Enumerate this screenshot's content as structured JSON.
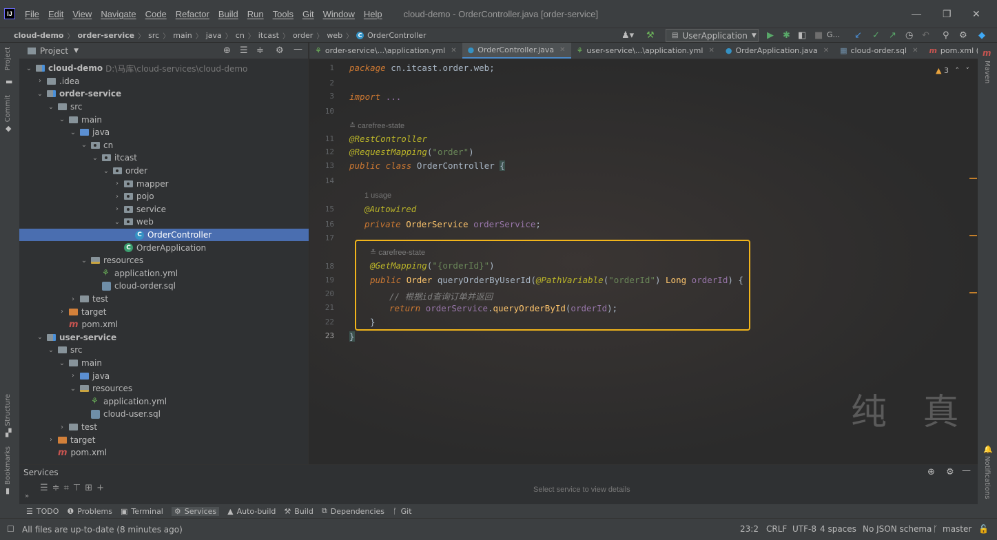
{
  "app": {
    "menu": [
      "File",
      "Edit",
      "View",
      "Navigate",
      "Code",
      "Refactor",
      "Build",
      "Run",
      "Tools",
      "Git",
      "Window",
      "Help"
    ],
    "window_title": "cloud-demo - OrderController.java [order-service]",
    "logo": "IJ"
  },
  "breadcrumb": [
    "cloud-demo",
    "order-service",
    "src",
    "main",
    "java",
    "cn",
    "itcast",
    "order",
    "web",
    "OrderController"
  ],
  "run_config": "UserApplication",
  "nav_extra": "G...",
  "project_panel": {
    "title": "Project",
    "tree": [
      {
        "label": "cloud-demo",
        "path": "D:\\马库\\cloud-services\\cloud-demo",
        "icon": "module",
        "expanded": true,
        "bold": true
      },
      {
        "label": ".idea",
        "icon": "folder",
        "expanded": false
      },
      {
        "label": "order-service",
        "icon": "module",
        "expanded": true,
        "bold": true
      },
      {
        "label": "src",
        "icon": "folder",
        "expanded": true
      },
      {
        "label": "main",
        "icon": "folder",
        "expanded": true
      },
      {
        "label": "java",
        "icon": "folder-blue",
        "expanded": true
      },
      {
        "label": "cn",
        "icon": "package",
        "expanded": true
      },
      {
        "label": "itcast",
        "icon": "package",
        "expanded": true
      },
      {
        "label": "order",
        "icon": "package",
        "expanded": true
      },
      {
        "label": "mapper",
        "icon": "package",
        "expanded": false
      },
      {
        "label": "pojo",
        "icon": "package",
        "expanded": false
      },
      {
        "label": "service",
        "icon": "package",
        "expanded": false
      },
      {
        "label": "web",
        "icon": "package",
        "expanded": true
      },
      {
        "label": "OrderController",
        "icon": "class",
        "selected": true
      },
      {
        "label": "OrderApplication",
        "icon": "class-app"
      },
      {
        "label": "resources",
        "icon": "folder-res",
        "expanded": true
      },
      {
        "label": "application.yml",
        "icon": "yml"
      },
      {
        "label": "cloud-order.sql",
        "icon": "sql"
      },
      {
        "label": "test",
        "icon": "folder",
        "expanded": false
      },
      {
        "label": "target",
        "icon": "folder-orange",
        "expanded": false
      },
      {
        "label": "pom.xml",
        "icon": "maven"
      },
      {
        "label": "user-service",
        "icon": "module",
        "expanded": true,
        "bold": true
      },
      {
        "label": "src",
        "icon": "folder",
        "expanded": true
      },
      {
        "label": "main",
        "icon": "folder",
        "expanded": true
      },
      {
        "label": "java",
        "icon": "folder-blue",
        "expanded": false
      },
      {
        "label": "resources",
        "icon": "folder-res",
        "expanded": true
      },
      {
        "label": "application.yml",
        "icon": "yml"
      },
      {
        "label": "cloud-user.sql",
        "icon": "sql"
      },
      {
        "label": "test",
        "icon": "folder",
        "expanded": false
      },
      {
        "label": "target",
        "icon": "folder-orange",
        "expanded": false
      },
      {
        "label": "pom.xml",
        "icon": "maven"
      }
    ]
  },
  "editor_tabs": [
    {
      "label": "order-service\\...\\application.yml",
      "icon": "yml"
    },
    {
      "label": "OrderController.java",
      "icon": "class",
      "active": true
    },
    {
      "label": "user-service\\...\\application.yml",
      "icon": "yml"
    },
    {
      "label": "OrderApplication.java",
      "icon": "class"
    },
    {
      "label": "cloud-order.sql",
      "icon": "sql"
    },
    {
      "label": "pom.xml (user-servic",
      "icon": "maven"
    }
  ],
  "editor": {
    "warnings": "3",
    "line_numbers": [
      "1",
      "2",
      "3",
      "10",
      "11",
      "12",
      "13",
      "14",
      "15",
      "16",
      "17",
      "18",
      "19",
      "20",
      "21",
      "22",
      "23"
    ],
    "author_hint": "carefree-state",
    "usage_hint": "1 usage",
    "code": {
      "package_kw": "package",
      "package_name": "cn.itcast.order.web;",
      "import_kw": "import",
      "import_fold": "...",
      "ann_rest": "@RestController",
      "ann_req": "@RequestMapping",
      "req_value": "\"order\"",
      "class_mods": "public class",
      "class_name": "OrderController",
      "ann_auto": "@Autowired",
      "field_mod": "private",
      "field_type": "OrderService",
      "field_name": "orderService",
      "ann_get": "@GetMapping",
      "get_value": "\"{orderId}\"",
      "method_mod": "public",
      "method_type": "Order",
      "method_name": "queryOrderByUserId",
      "param_ann": "@PathVariable",
      "param_value": "\"orderId\"",
      "param_type": "Long",
      "param_name": "orderId",
      "comment": "// 根据id查询订单并返回",
      "return_kw": "return",
      "call_obj": "orderService",
      "call_method": "queryOrderById",
      "call_arg": "orderId"
    },
    "decor_text": "纯 真"
  },
  "services": {
    "title": "Services",
    "empty": "Select service to view details"
  },
  "bottom_tools": [
    "TODO",
    "Problems",
    "Terminal",
    "Services",
    "Auto-build",
    "Build",
    "Dependencies",
    "Git"
  ],
  "status": {
    "message": "All files are up-to-date (8 minutes ago)",
    "position": "23:2",
    "line_sep": "CRLF",
    "encoding": "UTF-8",
    "indent": "4 spaces",
    "schema": "No JSON schema",
    "branch": "master"
  },
  "side_labels": {
    "project": "Project",
    "commit": "Commit",
    "structure": "Structure",
    "bookmarks": "Bookmarks",
    "maven": "Maven",
    "notifications": "Notifications"
  },
  "colors": {
    "accent": "#4a88c7",
    "selection": "#4a6eb0",
    "highlight_box": "#f2b51b",
    "keyword": "#cc7832",
    "annotation": "#bbb529",
    "string": "#6a8759"
  }
}
